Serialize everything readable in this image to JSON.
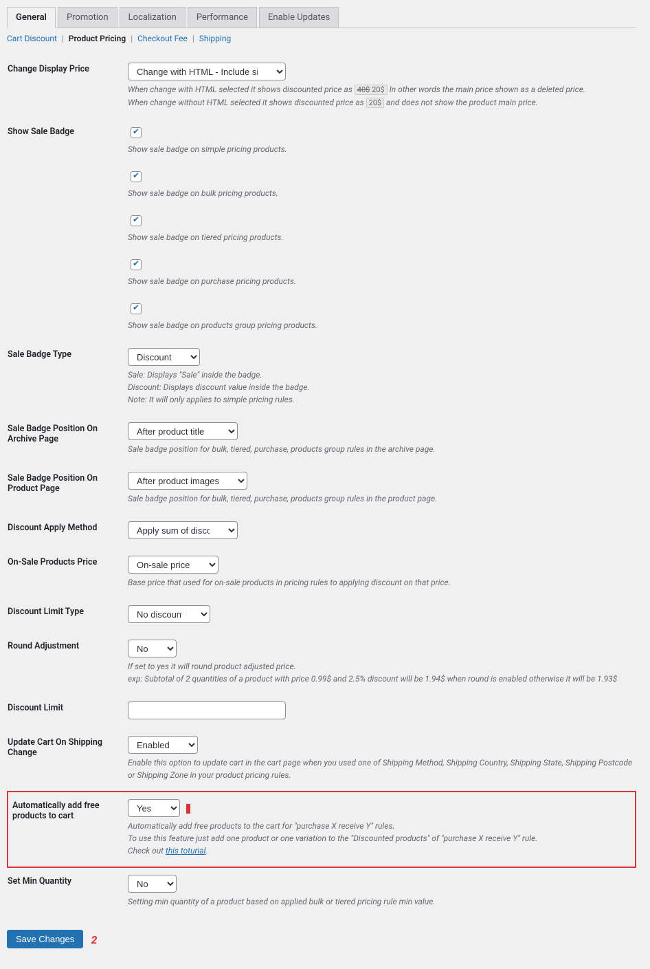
{
  "tabs": {
    "general": "General",
    "promotion": "Promotion",
    "localization": "Localization",
    "performance": "Performance",
    "enable_updates": "Enable Updates"
  },
  "subtabs": {
    "cart_discount": "Cart Discount",
    "product_pricing": "Product Pricing",
    "checkout_fee": "Checkout Fee",
    "shipping": "Shipping"
  },
  "fields": {
    "change_display_price": {
      "label": "Change Display Price",
      "value": "Change with HTML - Include simple adjustments",
      "desc_prefix": "When change with HTML selected it shows discounted price as ",
      "code1a": "40$",
      "code1b": "20$",
      "desc_mid": " In other words the main price shown as a deleted price.",
      "desc2_prefix": "When change without HTML selected it shows discounted price as ",
      "code2": "20$",
      "desc2_suffix": " and does not show the product main price."
    },
    "show_sale_badge": {
      "label": "Show Sale Badge",
      "items": [
        "Show sale badge on simple pricing products.",
        "Show sale badge on bulk pricing products.",
        "Show sale badge on tiered pricing products.",
        "Show sale badge on purchase pricing products.",
        "Show sale badge on products group pricing products."
      ]
    },
    "sale_badge_type": {
      "label": "Sale Badge Type",
      "value": "Discount",
      "desc1": "Sale: Displays \"Sale\" inside the badge.",
      "desc2": "Discount: Displays discount value inside the badge.",
      "desc3": "Note: It will only applies to simple pricing rules."
    },
    "sale_badge_pos_archive": {
      "label": "Sale Badge Position On Archive Page",
      "value": "After product title",
      "desc": "Sale badge position for bulk, tiered, purchase, products group rules in the archive page."
    },
    "sale_badge_pos_product": {
      "label": "Sale Badge Position On Product Page",
      "value": "After product images",
      "desc": "Sale badge position for bulk, tiered, purchase, products group rules in the product page."
    },
    "discount_apply_method": {
      "label": "Discount Apply Method",
      "value": "Apply sum of discounts"
    },
    "onsale_products_price": {
      "label": "On-Sale Products Price",
      "value": "On-sale price",
      "desc": "Base price that used for on-sale products in pricing rules to applying discount on that price."
    },
    "discount_limit_type": {
      "label": "Discount Limit Type",
      "value": "No discount limit"
    },
    "round_adjustment": {
      "label": "Round Adjustment",
      "value": "No",
      "desc1": "If set to yes it will round product adjusted price.",
      "desc2": "exp: Subtotal of 2 quantities of a product with price 0.99$ and 2.5% discount will be 1.94$ when round is enabled otherwise it will be 1.93$"
    },
    "discount_limit": {
      "label": "Discount Limit",
      "value": ""
    },
    "update_cart_shipping": {
      "label": "Update Cart On Shipping Change",
      "value": "Enabled",
      "desc": "Enable this option to update cart in the cart page when you used one of Shipping Method, Shipping Country, Shipping State, Shipping Postcode or Shipping Zone in your product pricing rules."
    },
    "auto_add_free": {
      "label": "Automatically add free products to cart",
      "value": "Yes",
      "desc1": "Automatically add free products to the cart for \"purchase X receive Y\" rules.",
      "desc2": "To use this feature just add one product or one variation to the \"Discounted products\" of \"purchase X receive Y\" rule.",
      "desc3_prefix": "Check out ",
      "desc3_link": "this toturial",
      "desc3_suffix": "."
    },
    "set_min_qty": {
      "label": "Set Min Quantity",
      "value": "No",
      "desc": "Setting min quantity of a product based on applied bulk or tiered pricing rule min value."
    }
  },
  "buttons": {
    "save": "Save Changes"
  },
  "callouts": {
    "c1": "1",
    "c2": "2"
  }
}
